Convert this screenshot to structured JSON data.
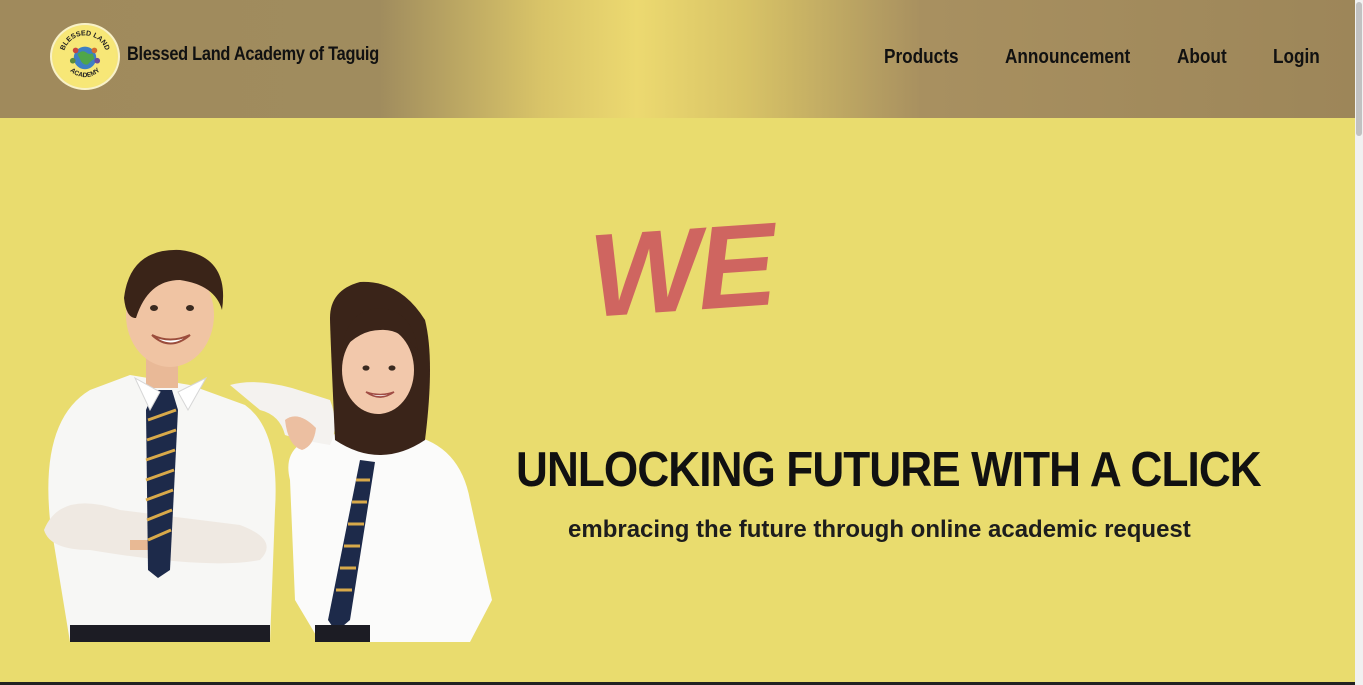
{
  "header": {
    "school_name": "Blessed Land Academy of Taguig",
    "logo_text_top": "BLESSED LAND",
    "logo_text_bottom": "ACADEMY"
  },
  "nav": {
    "products": "Products",
    "announcement": "Announcement",
    "about": "About",
    "login": "Login"
  },
  "hero": {
    "animated_word": "WE",
    "title": "UNLOCKING FUTURE WITH A CLICK",
    "subtitle": "embracing the future through online academic request"
  },
  "colors": {
    "header_gradient_edge": "#a08a5c",
    "header_gradient_center": "#ecd970",
    "page_background": "#e9dc6e",
    "accent_word": "#cf6560"
  }
}
